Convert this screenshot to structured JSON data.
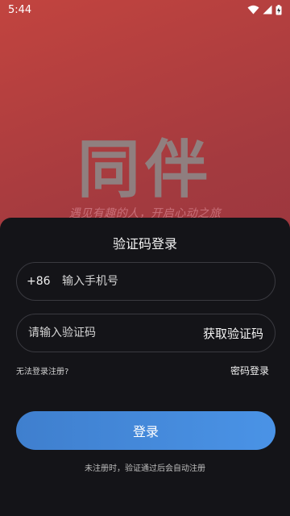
{
  "status_bar": {
    "time": "5:44"
  },
  "brand": {
    "logo_text": "同伴",
    "slogan": "遇见有趣的人，开启心动之旅"
  },
  "login": {
    "title": "验证码登录",
    "country_code": "+86",
    "phone_placeholder": "输入手机号",
    "code_placeholder": "请输入验证码",
    "get_code_label": "获取验证码",
    "cannot_register": "无法登录注册?",
    "password_login": "密码登录",
    "login_button": "登录",
    "footnote": "未注册时，验证通过后会自动注册"
  },
  "colors": {
    "accent": "#4a90e2",
    "sheet_bg": "#141418",
    "background_top": "#c2443f",
    "background_bottom": "#8a2f3d"
  },
  "icons": [
    "wifi-icon",
    "signal-icon",
    "battery-charging-icon"
  ]
}
